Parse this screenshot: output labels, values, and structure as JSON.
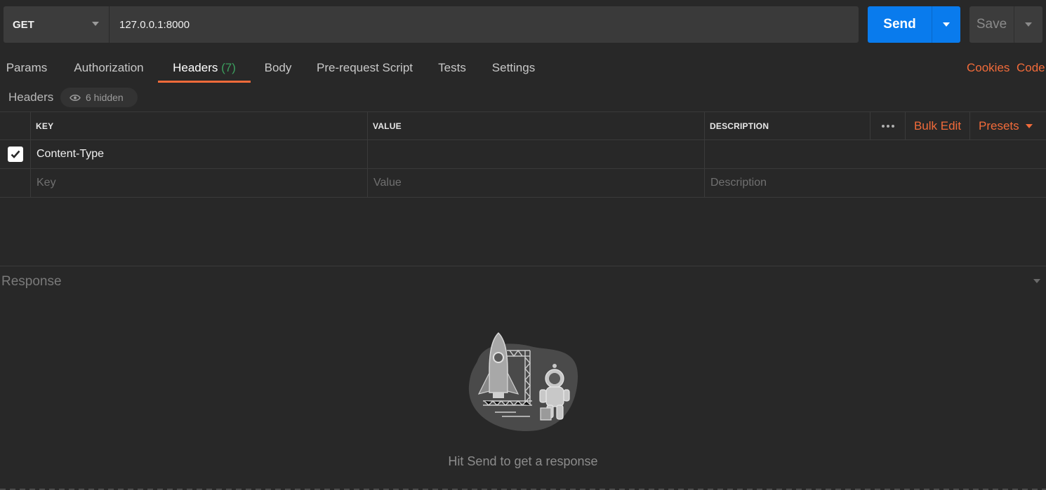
{
  "request": {
    "method": "GET",
    "url": "127.0.0.1:8000",
    "send_label": "Send",
    "save_label": "Save"
  },
  "tabs": [
    {
      "label": "Params"
    },
    {
      "label": "Authorization"
    },
    {
      "label": "Headers",
      "count": "(7)",
      "active": true
    },
    {
      "label": "Body"
    },
    {
      "label": "Pre-request Script"
    },
    {
      "label": "Tests"
    },
    {
      "label": "Settings"
    }
  ],
  "links": {
    "cookies": "Cookies",
    "code": "Code"
  },
  "headers_section": {
    "title": "Headers",
    "hidden_label": "6 hidden"
  },
  "table": {
    "columns": [
      "KEY",
      "VALUE",
      "DESCRIPTION"
    ],
    "bulk_edit": "Bulk Edit",
    "presets": "Presets",
    "rows": [
      {
        "checked": true,
        "key": "Content-Type",
        "value": "",
        "description": ""
      }
    ],
    "placeholders": {
      "key": "Key",
      "value": "Value",
      "description": "Description"
    }
  },
  "response": {
    "title": "Response",
    "hint": "Hit Send to get a response"
  },
  "colors": {
    "accent": "#f26b3a",
    "send_blue": "#097bed",
    "count_green": "#3b9f5e",
    "background": "#282828"
  }
}
